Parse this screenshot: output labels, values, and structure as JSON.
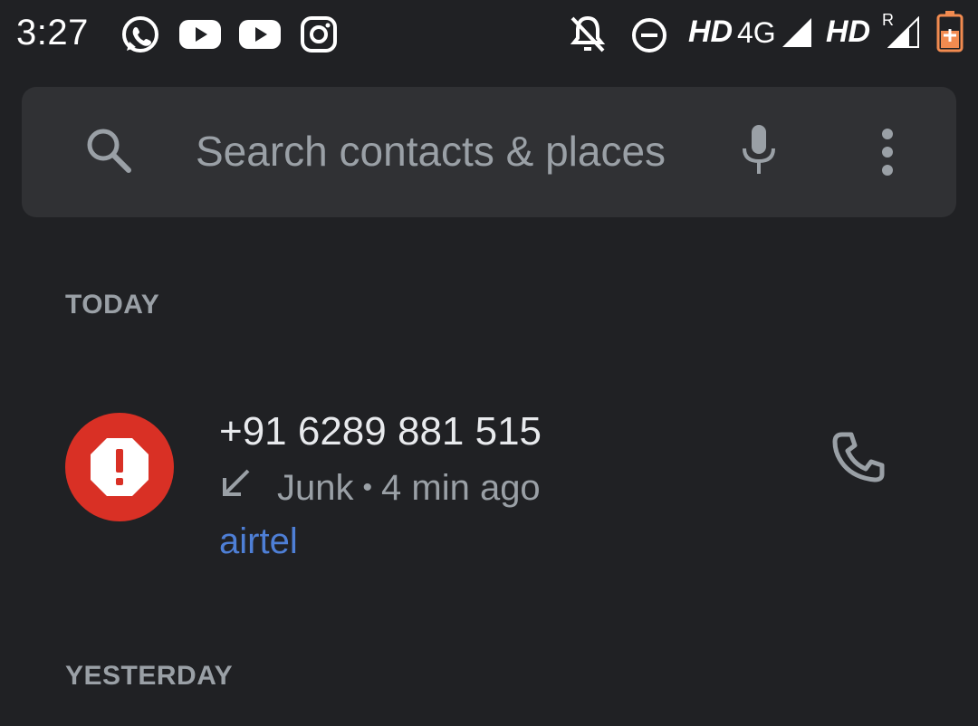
{
  "status_bar": {
    "time": "3:27",
    "apps": [
      "whatsapp-icon",
      "youtube-icon",
      "youtube-icon",
      "instagram-icon"
    ],
    "right_icons": [
      "notifications-off-icon",
      "do-not-disturb-icon"
    ],
    "hd1": "HD",
    "network": "4G",
    "hd2": "HD",
    "roaming": "R",
    "battery_color": "#f28b50"
  },
  "search": {
    "placeholder": "Search contacts & places"
  },
  "sections": {
    "today": "TODAY",
    "yesterday": "YESTERDAY"
  },
  "calls": [
    {
      "number": "+91 6289 881 515",
      "type": "Junk",
      "separator": "•",
      "time": "4 min ago",
      "carrier": "airtel",
      "avatar_color": "#d93025",
      "direction": "incoming"
    }
  ]
}
